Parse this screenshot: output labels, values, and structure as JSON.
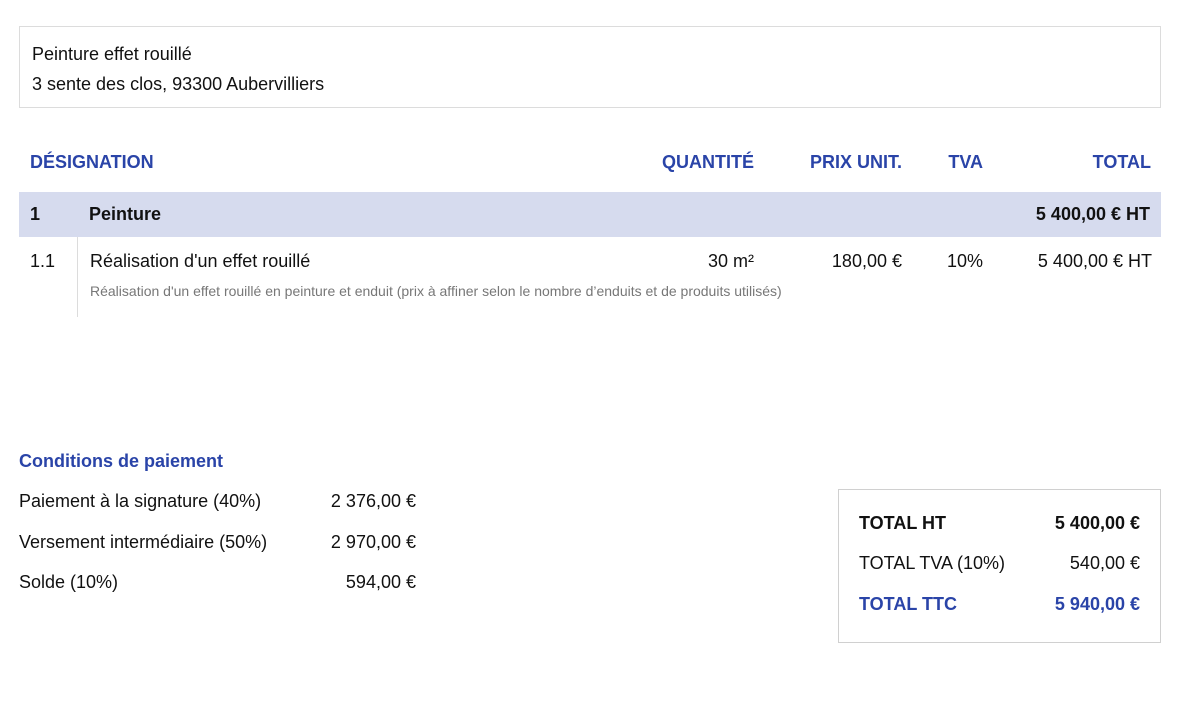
{
  "client": {
    "name": "Peinture effet rouillé",
    "address": "3 sente des clos, 93300 Aubervilliers"
  },
  "table": {
    "headers": {
      "designation": "DÉSIGNATION",
      "quantite": "QUANTITÉ",
      "prix_unit": "PRIX UNIT.",
      "tva": "TVA",
      "total": "TOTAL"
    },
    "section": {
      "number": "1",
      "title": "Peinture",
      "total": "5 400,00 € HT"
    },
    "items": [
      {
        "number": "1.1",
        "label": "Réalisation d'un effet rouillé",
        "quantity": "30 m²",
        "unit_price": "180,00 €",
        "tva": "10%",
        "total": "5 400,00 € HT",
        "description": "Réalisation d'un effet rouillé en peinture et enduit (prix à affiner selon le nombre d’enduits et de produits utilisés)"
      }
    ]
  },
  "payment": {
    "title": "Conditions de paiement",
    "rows": [
      {
        "label": "Paiement à la signature (40%)",
        "amount": "2 376,00 €"
      },
      {
        "label": "Versement intermédiaire (50%)",
        "amount": "2 970,00 €"
      },
      {
        "label": "Solde (10%)",
        "amount": "594,00 €"
      }
    ]
  },
  "totals": {
    "ht_label": "TOTAL HT",
    "ht_value": "5 400,00 €",
    "tva_label": "TOTAL TVA (10%)",
    "tva_value": "540,00 €",
    "ttc_label": "TOTAL TTC",
    "ttc_value": "5 940,00 €"
  },
  "colors": {
    "accent": "#2a44a8",
    "section_bg": "#d6dbee",
    "muted_text": "#777777"
  }
}
